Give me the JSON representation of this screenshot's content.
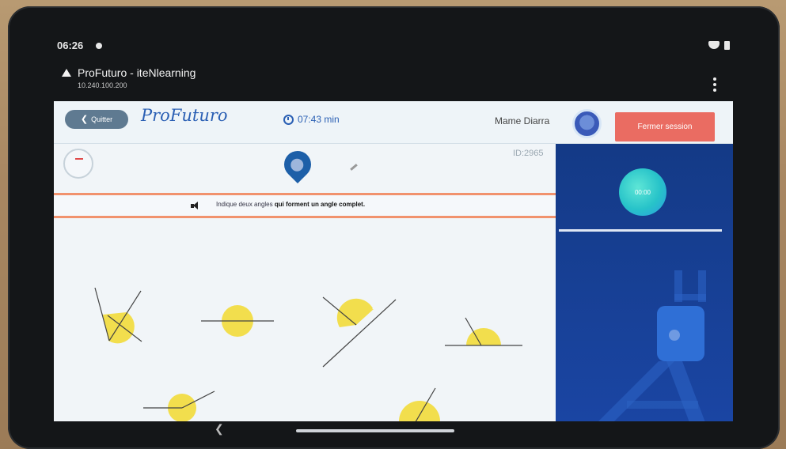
{
  "status": {
    "time": "06:26"
  },
  "notification": {
    "title": "ProFuturo - iteNlearning",
    "subtitle": "10.240.100.200"
  },
  "topbar": {
    "quit_label": "Quitter",
    "brand": "ProFuturo",
    "timer": "07:43 min",
    "user_name": "Mame Diarra",
    "logout_label": "Fermer session"
  },
  "question": {
    "id": "ID:2965",
    "instruction_pre": "Indique deux angles ",
    "instruction_bold": "qui forment un angle complet."
  },
  "sidebar": {
    "countdown": "00:00"
  },
  "colors": {
    "brand": "#2a5fb4",
    "logout": "#ea6c62",
    "band": "#f1926d",
    "sidebar": "#143a86",
    "angle_fill": "#f2de4d"
  }
}
